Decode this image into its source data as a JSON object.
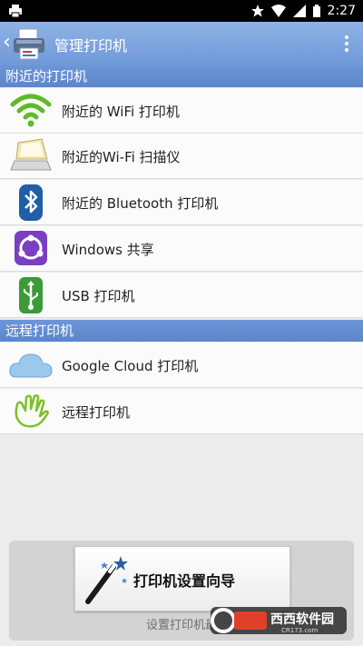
{
  "status_bar": {
    "time": "2:27",
    "left_icon": "printer-notification-icon",
    "icons": [
      "star-icon",
      "wifi-icon",
      "signal-icon",
      "battery-icon"
    ]
  },
  "action_bar": {
    "title": "管理打印机",
    "back_icon": "chevron-left-icon",
    "app_icon": "printer-app-icon",
    "overflow_icon": "more-vert-icon"
  },
  "sections": [
    {
      "header": "附近的打印机",
      "items": [
        {
          "label": "附近的 WiFi 打印机",
          "icon": "wifi-icon"
        },
        {
          "label": "附近的Wi-Fi 扫描仪",
          "icon": "scanner-icon"
        },
        {
          "label": "附近的 Bluetooth 打印机",
          "icon": "bluetooth-icon"
        },
        {
          "label": "Windows 共享",
          "icon": "windows-share-icon"
        },
        {
          "label": "USB 打印机",
          "icon": "usb-icon"
        }
      ]
    },
    {
      "header": "远程打印机",
      "items": [
        {
          "label": "Google Cloud 打印机",
          "icon": "cloud-icon"
        },
        {
          "label": "远程打印机",
          "icon": "remote-hand-icon"
        }
      ]
    }
  ],
  "bottom": {
    "wizard_label": "打印机设置向导",
    "hint_text": "设置打印机最",
    "wizard_icon": "magic-wand-icon"
  },
  "watermark": {
    "brand": "西西软件园",
    "url": "CR173.com"
  },
  "colors": {
    "action_bar": "#7ea6e0",
    "section": "#6690d6",
    "background": "#ececec"
  }
}
